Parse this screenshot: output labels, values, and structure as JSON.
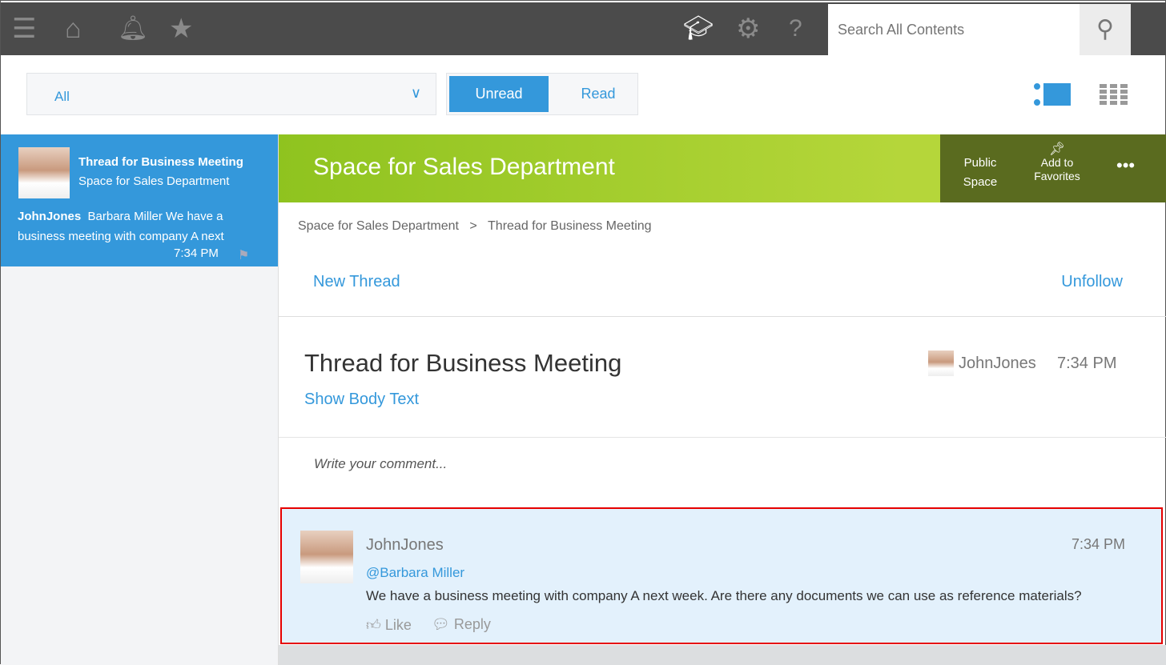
{
  "topbar": {
    "search_placeholder": "Search All Contents"
  },
  "filter": {
    "selected": "All"
  },
  "toggle": {
    "unread": "Unread",
    "read": "Read"
  },
  "sidebar": {
    "items": [
      {
        "title": "Thread for Business Meeting",
        "space": "Space for Sales Department",
        "author": "JohnJones",
        "preview": "Barbara Miller We have a business meeting with company A next",
        "time": "7:34 PM"
      }
    ]
  },
  "space": {
    "title": "Space for Sales Department",
    "public": "Public Space",
    "favorites": "Add to Favorites",
    "more": "•••"
  },
  "breadcrumb": {
    "space": "Space for Sales Department",
    "sep": ">",
    "thread": "Thread for Business Meeting"
  },
  "actions": {
    "new_thread": "New Thread",
    "unfollow": "Unfollow"
  },
  "thread": {
    "title": "Thread for Business Meeting",
    "show_body": "Show Body Text",
    "author": "JohnJones",
    "time": "7:34 PM"
  },
  "comment_box": {
    "placeholder": "Write your comment..."
  },
  "comment": {
    "author": "JohnJones",
    "time": "7:34 PM",
    "mention": "@Barbara Miller",
    "text": "We have a business meeting with company A next week. Are there any documents we can use as reference materials?",
    "like": "Like",
    "reply": "Reply"
  }
}
